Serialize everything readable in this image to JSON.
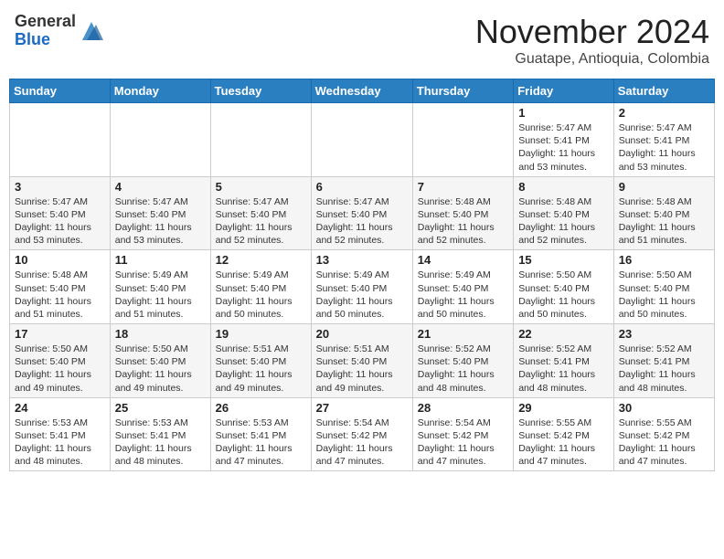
{
  "header": {
    "logo_line1": "General",
    "logo_line2": "Blue",
    "month": "November 2024",
    "location": "Guatape, Antioquia, Colombia"
  },
  "weekdays": [
    "Sunday",
    "Monday",
    "Tuesday",
    "Wednesday",
    "Thursday",
    "Friday",
    "Saturday"
  ],
  "rows": [
    {
      "alt": false,
      "cells": [
        {
          "day": "",
          "info": ""
        },
        {
          "day": "",
          "info": ""
        },
        {
          "day": "",
          "info": ""
        },
        {
          "day": "",
          "info": ""
        },
        {
          "day": "",
          "info": ""
        },
        {
          "day": "1",
          "info": "Sunrise: 5:47 AM\nSunset: 5:41 PM\nDaylight: 11 hours\nand 53 minutes."
        },
        {
          "day": "2",
          "info": "Sunrise: 5:47 AM\nSunset: 5:41 PM\nDaylight: 11 hours\nand 53 minutes."
        }
      ]
    },
    {
      "alt": true,
      "cells": [
        {
          "day": "3",
          "info": "Sunrise: 5:47 AM\nSunset: 5:40 PM\nDaylight: 11 hours\nand 53 minutes."
        },
        {
          "day": "4",
          "info": "Sunrise: 5:47 AM\nSunset: 5:40 PM\nDaylight: 11 hours\nand 53 minutes."
        },
        {
          "day": "5",
          "info": "Sunrise: 5:47 AM\nSunset: 5:40 PM\nDaylight: 11 hours\nand 52 minutes."
        },
        {
          "day": "6",
          "info": "Sunrise: 5:47 AM\nSunset: 5:40 PM\nDaylight: 11 hours\nand 52 minutes."
        },
        {
          "day": "7",
          "info": "Sunrise: 5:48 AM\nSunset: 5:40 PM\nDaylight: 11 hours\nand 52 minutes."
        },
        {
          "day": "8",
          "info": "Sunrise: 5:48 AM\nSunset: 5:40 PM\nDaylight: 11 hours\nand 52 minutes."
        },
        {
          "day": "9",
          "info": "Sunrise: 5:48 AM\nSunset: 5:40 PM\nDaylight: 11 hours\nand 51 minutes."
        }
      ]
    },
    {
      "alt": false,
      "cells": [
        {
          "day": "10",
          "info": "Sunrise: 5:48 AM\nSunset: 5:40 PM\nDaylight: 11 hours\nand 51 minutes."
        },
        {
          "day": "11",
          "info": "Sunrise: 5:49 AM\nSunset: 5:40 PM\nDaylight: 11 hours\nand 51 minutes."
        },
        {
          "day": "12",
          "info": "Sunrise: 5:49 AM\nSunset: 5:40 PM\nDaylight: 11 hours\nand 50 minutes."
        },
        {
          "day": "13",
          "info": "Sunrise: 5:49 AM\nSunset: 5:40 PM\nDaylight: 11 hours\nand 50 minutes."
        },
        {
          "day": "14",
          "info": "Sunrise: 5:49 AM\nSunset: 5:40 PM\nDaylight: 11 hours\nand 50 minutes."
        },
        {
          "day": "15",
          "info": "Sunrise: 5:50 AM\nSunset: 5:40 PM\nDaylight: 11 hours\nand 50 minutes."
        },
        {
          "day": "16",
          "info": "Sunrise: 5:50 AM\nSunset: 5:40 PM\nDaylight: 11 hours\nand 50 minutes."
        }
      ]
    },
    {
      "alt": true,
      "cells": [
        {
          "day": "17",
          "info": "Sunrise: 5:50 AM\nSunset: 5:40 PM\nDaylight: 11 hours\nand 49 minutes."
        },
        {
          "day": "18",
          "info": "Sunrise: 5:50 AM\nSunset: 5:40 PM\nDaylight: 11 hours\nand 49 minutes."
        },
        {
          "day": "19",
          "info": "Sunrise: 5:51 AM\nSunset: 5:40 PM\nDaylight: 11 hours\nand 49 minutes."
        },
        {
          "day": "20",
          "info": "Sunrise: 5:51 AM\nSunset: 5:40 PM\nDaylight: 11 hours\nand 49 minutes."
        },
        {
          "day": "21",
          "info": "Sunrise: 5:52 AM\nSunset: 5:40 PM\nDaylight: 11 hours\nand 48 minutes."
        },
        {
          "day": "22",
          "info": "Sunrise: 5:52 AM\nSunset: 5:41 PM\nDaylight: 11 hours\nand 48 minutes."
        },
        {
          "day": "23",
          "info": "Sunrise: 5:52 AM\nSunset: 5:41 PM\nDaylight: 11 hours\nand 48 minutes."
        }
      ]
    },
    {
      "alt": false,
      "cells": [
        {
          "day": "24",
          "info": "Sunrise: 5:53 AM\nSunset: 5:41 PM\nDaylight: 11 hours\nand 48 minutes."
        },
        {
          "day": "25",
          "info": "Sunrise: 5:53 AM\nSunset: 5:41 PM\nDaylight: 11 hours\nand 48 minutes."
        },
        {
          "day": "26",
          "info": "Sunrise: 5:53 AM\nSunset: 5:41 PM\nDaylight: 11 hours\nand 47 minutes."
        },
        {
          "day": "27",
          "info": "Sunrise: 5:54 AM\nSunset: 5:42 PM\nDaylight: 11 hours\nand 47 minutes."
        },
        {
          "day": "28",
          "info": "Sunrise: 5:54 AM\nSunset: 5:42 PM\nDaylight: 11 hours\nand 47 minutes."
        },
        {
          "day": "29",
          "info": "Sunrise: 5:55 AM\nSunset: 5:42 PM\nDaylight: 11 hours\nand 47 minutes."
        },
        {
          "day": "30",
          "info": "Sunrise: 5:55 AM\nSunset: 5:42 PM\nDaylight: 11 hours\nand 47 minutes."
        }
      ]
    }
  ]
}
